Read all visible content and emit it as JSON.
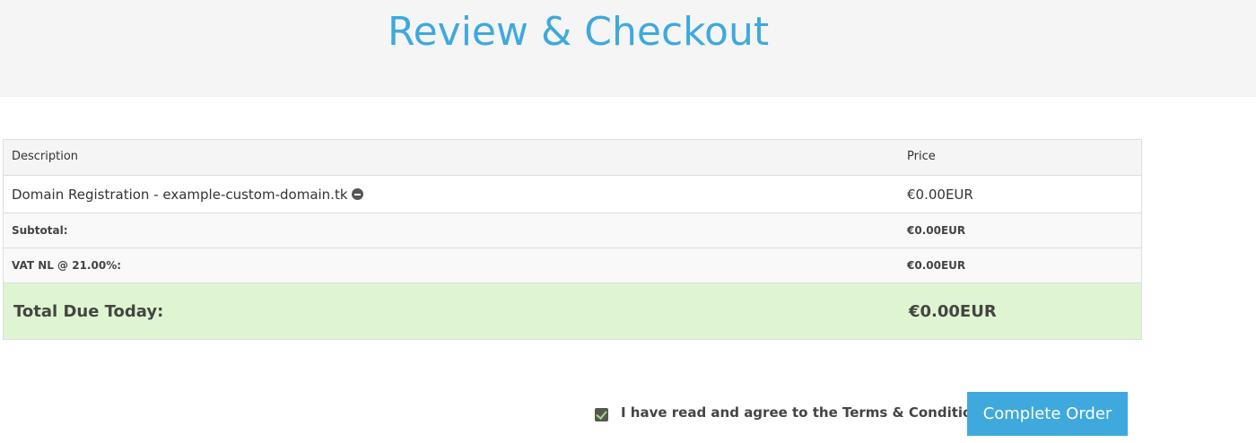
{
  "page": {
    "title": "Review & Checkout"
  },
  "table": {
    "headers": {
      "description": "Description",
      "price": "Price"
    },
    "items": [
      {
        "description": "Domain Registration - example-custom-domain.tk",
        "price": "€0.00EUR",
        "remove_icon": "remove-circle-icon"
      }
    ],
    "subtotal": {
      "label": "Subtotal:",
      "value": "€0.00EUR"
    },
    "tax": {
      "label": "VAT NL @ 21.00%:",
      "value": "€0.00EUR"
    },
    "total": {
      "label": "Total Due Today:",
      "value": "€0.00EUR"
    }
  },
  "agreement": {
    "checked": true,
    "label": "I have read and agree to the Terms & Conditions"
  },
  "actions": {
    "complete_label": "Complete Order"
  },
  "colors": {
    "accent": "#3fa9dd",
    "total_row_bg": "#dff5d1",
    "header_band_bg": "#f5f5f5"
  }
}
